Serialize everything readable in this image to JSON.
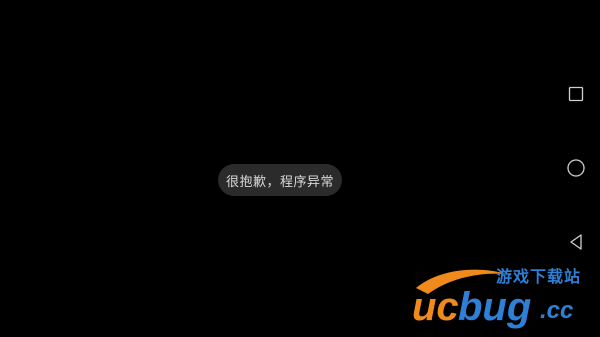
{
  "toast": {
    "message": "很抱歉，程序异常"
  },
  "navigation": {
    "recent_icon": "square-recents-icon",
    "home_icon": "circle-home-icon",
    "back_icon": "triangle-back-icon",
    "icon_color": "#d0d0d0"
  },
  "watermark": {
    "brand": "ucbug.cc",
    "tagline": "游戏下载站",
    "colors": {
      "orange": "#f08a1c",
      "blue": "#2e7fd6"
    }
  }
}
